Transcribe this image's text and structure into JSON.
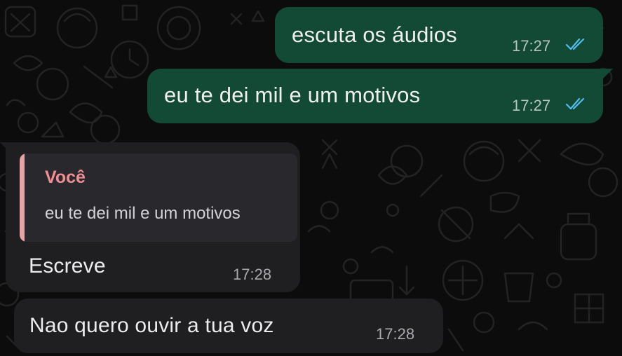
{
  "chat": {
    "messages": [
      {
        "direction": "outgoing",
        "text": "escuta os áudios",
        "time": "17:27",
        "status_icon": "double-check-read-icon"
      },
      {
        "direction": "outgoing",
        "text": "eu te dei mil e um motivos",
        "time": "17:27",
        "status_icon": "double-check-read-icon"
      },
      {
        "direction": "incoming",
        "reply_to": {
          "author": "Você",
          "text": "eu te dei mil e um motivos"
        },
        "text": "Escreve",
        "time": "17:28"
      },
      {
        "direction": "incoming",
        "text": "Nao quero ouvir a tua voz",
        "time": "17:28"
      }
    ]
  },
  "colors": {
    "background": "#0c0c0c",
    "outgoing_bubble": "#124a35",
    "incoming_bubble": "#1f1f22",
    "quote_bar": "#e8a3a7",
    "quote_author": "#f08e93",
    "read_ticks": "#53bdeb"
  }
}
